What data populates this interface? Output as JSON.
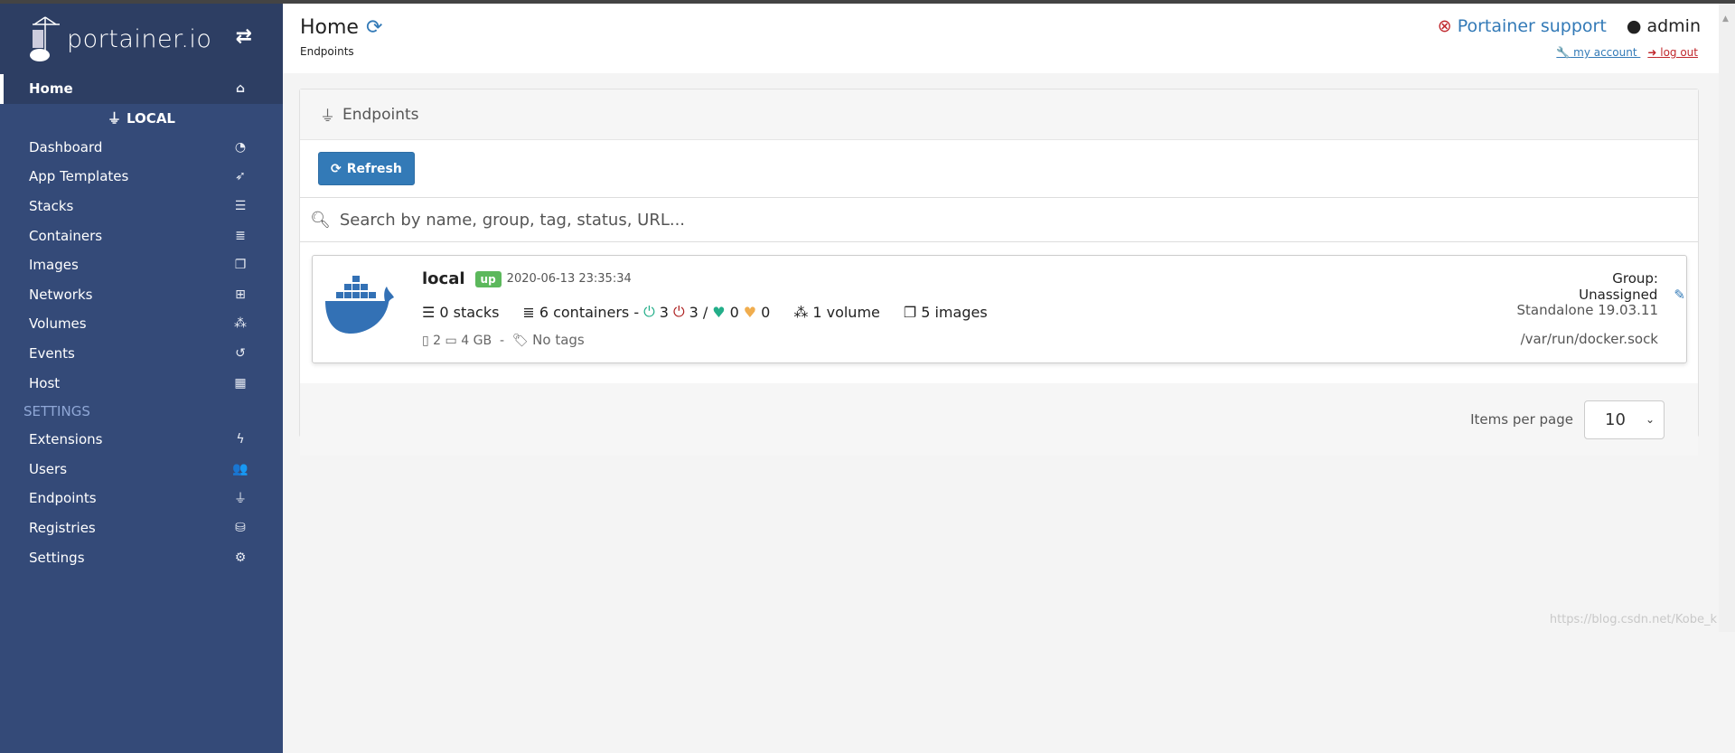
{
  "sidebar": {
    "logo": "portainer.io",
    "home": "Home",
    "endpoint": "LOCAL",
    "items": [
      {
        "label": "Dashboard",
        "icon": "tachometer-icon",
        "glyph": "◔"
      },
      {
        "label": "App Templates",
        "icon": "rocket-icon",
        "glyph": "➶"
      },
      {
        "label": "Stacks",
        "icon": "th-list-icon",
        "glyph": "☰"
      },
      {
        "label": "Containers",
        "icon": "server-icon",
        "glyph": "≣"
      },
      {
        "label": "Images",
        "icon": "clone-icon",
        "glyph": "❐"
      },
      {
        "label": "Networks",
        "icon": "sitemap-icon",
        "glyph": "⊞"
      },
      {
        "label": "Volumes",
        "icon": "cubes-icon",
        "glyph": "⁂"
      },
      {
        "label": "Events",
        "icon": "history-icon",
        "glyph": "↺"
      },
      {
        "label": "Host",
        "icon": "th-icon",
        "glyph": "▦"
      }
    ],
    "settings_heading": "SETTINGS",
    "settings": [
      {
        "label": "Extensions",
        "icon": "bolt-icon",
        "glyph": "ϟ"
      },
      {
        "label": "Users",
        "icon": "users-icon",
        "glyph": "👥"
      },
      {
        "label": "Endpoints",
        "icon": "plug-icon",
        "glyph": "⏚"
      },
      {
        "label": "Registries",
        "icon": "database-icon",
        "glyph": "⛁"
      },
      {
        "label": "Settings",
        "icon": "cogs-icon",
        "glyph": "⚙"
      }
    ]
  },
  "header": {
    "title": "Home",
    "subtitle": "Endpoints",
    "support": "Portainer support",
    "user": "admin",
    "my_account": " my account ",
    "log_out": " log out"
  },
  "panel": {
    "title": "Endpoints",
    "refresh": "Refresh",
    "search_placeholder": "Search by name, group, tag, status, URL...",
    "endpoint": {
      "name": "local",
      "status": "up",
      "date": "2020-06-13 23:35:34",
      "stacks": "0 stacks",
      "containers": "6 containers -",
      "running": "3",
      "stopped": "3 /",
      "healthy": "0",
      "unhealthy": "0",
      "volumes": "1 volume",
      "images": "5 images",
      "cpu": "2",
      "memory": "4 GB",
      "sep": "-",
      "tags": "No tags",
      "group": "Group: Unassigned",
      "type": "Standalone 19.03.11",
      "url": "/var/run/docker.sock"
    },
    "items_per_page_label": "Items per page",
    "items_per_page": "10"
  },
  "colors": {
    "sidebar": "#2d3e63",
    "primary": "#337ab7",
    "up": "#5cb85c",
    "running": "#23ae89",
    "stopped": "#ae2323",
    "healthy": "#23ae89",
    "unhealthy": "#f0ad4e"
  },
  "watermark": "https://blog.csdn.net/Kobe_k"
}
